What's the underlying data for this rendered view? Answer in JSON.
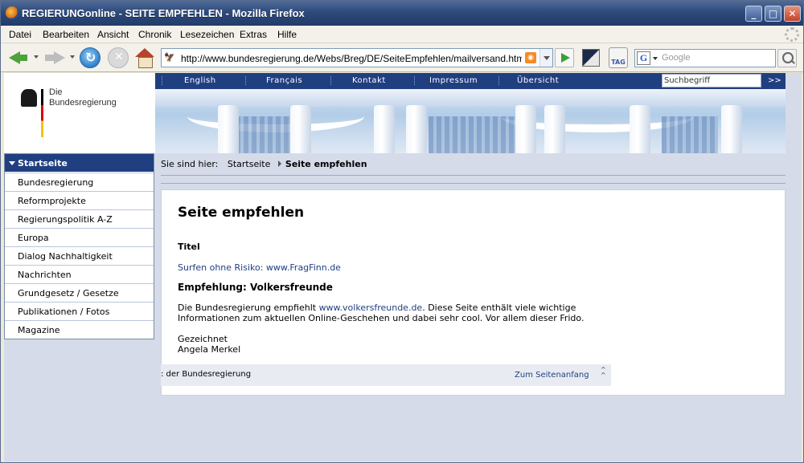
{
  "window": {
    "title": "REGIERUNGonline - SEITE EMPFEHLEN - Mozilla Firefox"
  },
  "menubar": [
    "Datei",
    "Bearbeiten",
    "Ansicht",
    "Chronik",
    "Lesezeichen",
    "Extras",
    "Hilfe"
  ],
  "navbar": {
    "url": "http://www.bundesregierung.de/Webs/Breg/DE/SeiteEmpfehlen/mailversand.html?hand",
    "tag_label": "TAG",
    "search_engine_letter": "G",
    "search_placeholder": "Google"
  },
  "site": {
    "logo_line1": "Die",
    "logo_line2": "Bundesregierung",
    "topnav": [
      "English",
      "Français",
      "Kontakt",
      "Impressum",
      "Übersicht"
    ],
    "search_value": "Suchbegriff",
    "search_go": ">>",
    "sidenav_head": "Startseite",
    "sidenav": [
      "Bundesregierung",
      "Reformprojekte",
      "Regierungspolitik A-Z",
      "Europa",
      "Dialog Nachhaltigkeit",
      "Nachrichten",
      "Grundgesetz / Gesetze",
      "Publikationen / Fotos",
      "Magazine"
    ],
    "breadcrumb_label": "Sie sind hier:",
    "breadcrumb_home": "Startseite",
    "breadcrumb_current": "Seite empfehlen"
  },
  "content": {
    "heading": "Seite empfehlen",
    "label": "Titel",
    "teaser": "Surfen ohne Risiko: www.FragFinn.de",
    "subheading": "Empfehlung: Volkersfreunde",
    "para_pre": "Die Bundesregierung empfiehlt ",
    "para_link": "www.volkersfreunde.de",
    "para_post": ". Diese Seite enthält viele wichtige Informationen zum aktuellen Online-Geschehen und dabei sehr cool. Vor allem dieser Frido.",
    "sig1": "Gezeichnet",
    "sig2": "Angela Merkel",
    "footer_text": ": der Bundesregierung",
    "footer_top": "Zum Seitenanfang"
  }
}
